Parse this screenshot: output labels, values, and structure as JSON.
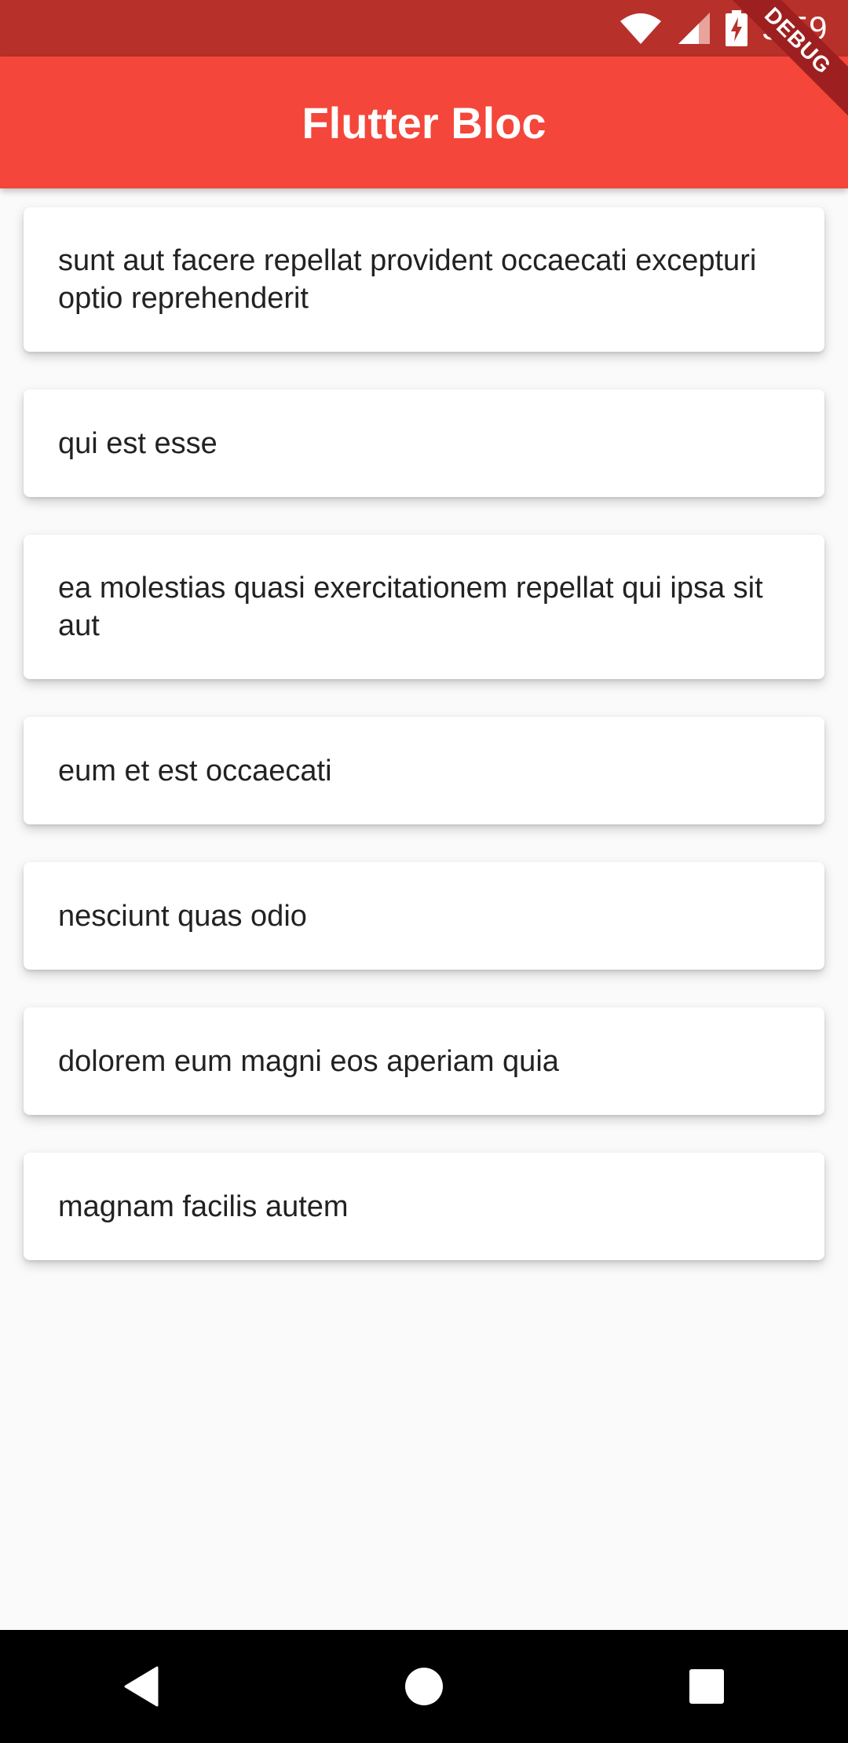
{
  "status_bar": {
    "time": "5:59",
    "icons": [
      "wifi-icon",
      "cell-signal-icon",
      "battery-charging-icon"
    ]
  },
  "debug_banner": "DEBUG",
  "app_bar": {
    "title": "Flutter Bloc"
  },
  "posts": [
    "sunt aut facere repellat provident occaecati excepturi optio reprehenderit",
    "qui est esse",
    "ea molestias quasi exercitationem repellat qui ipsa sit aut",
    "eum et est occaecati",
    "nesciunt quas odio",
    "dolorem eum magni eos aperiam quia",
    "magnam facilis autem"
  ],
  "nav_bar": {
    "buttons": [
      "back-icon",
      "home-icon",
      "recents-icon"
    ]
  },
  "colors": {
    "status_bar": "#b7312a",
    "app_bar": "#f4463a",
    "background": "#fafafa",
    "card": "#ffffff",
    "debug_banner": "#9e1f1f"
  }
}
